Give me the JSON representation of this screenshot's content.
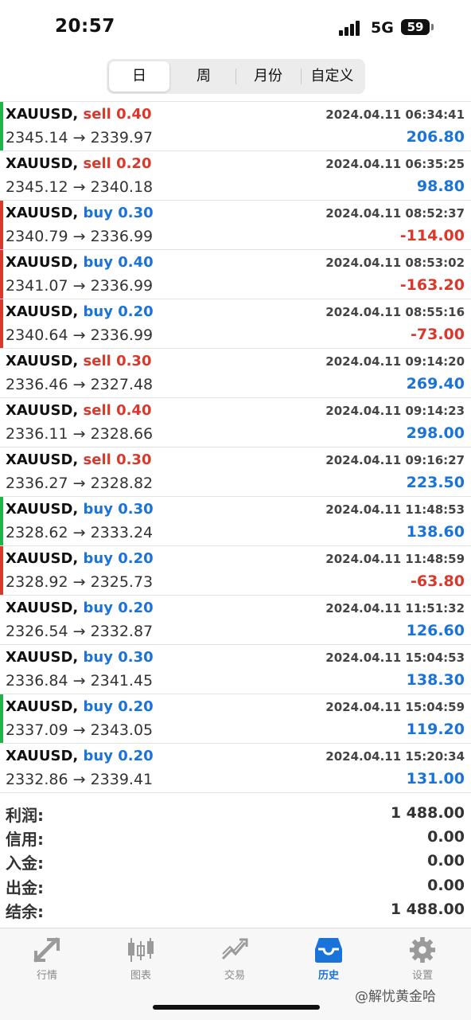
{
  "status_bar": {
    "time": "20:57",
    "network": "5G",
    "battery": "59"
  },
  "period_tabs": [
    {
      "label": "日",
      "active": true
    },
    {
      "label": "周",
      "active": false
    },
    {
      "label": "月份",
      "active": false
    },
    {
      "label": "自定义",
      "active": false
    }
  ],
  "trades": [
    {
      "symbol": "XAUUSD,",
      "direction": "sell",
      "volume": "0.40",
      "prices": "2345.14 → 2339.97",
      "time": "2024.04.11 06:34:41",
      "profit": "206.80",
      "profit_color": "blue",
      "marker": "green"
    },
    {
      "symbol": "XAUUSD,",
      "direction": "sell",
      "volume": "0.20",
      "prices": "2345.12 → 2340.18",
      "time": "2024.04.11 06:35:25",
      "profit": "98.80",
      "profit_color": "blue",
      "marker": "none"
    },
    {
      "symbol": "XAUUSD,",
      "direction": "buy",
      "volume": "0.30",
      "prices": "2340.79 → 2336.99",
      "time": "2024.04.11 08:52:37",
      "profit": "-114.00",
      "profit_color": "red",
      "marker": "red"
    },
    {
      "symbol": "XAUUSD,",
      "direction": "buy",
      "volume": "0.40",
      "prices": "2341.07 → 2336.99",
      "time": "2024.04.11 08:53:02",
      "profit": "-163.20",
      "profit_color": "red",
      "marker": "red"
    },
    {
      "symbol": "XAUUSD,",
      "direction": "buy",
      "volume": "0.20",
      "prices": "2340.64 → 2336.99",
      "time": "2024.04.11 08:55:16",
      "profit": "-73.00",
      "profit_color": "red",
      "marker": "red"
    },
    {
      "symbol": "XAUUSD,",
      "direction": "sell",
      "volume": "0.30",
      "prices": "2336.46 → 2327.48",
      "time": "2024.04.11 09:14:20",
      "profit": "269.40",
      "profit_color": "blue",
      "marker": "none"
    },
    {
      "symbol": "XAUUSD,",
      "direction": "sell",
      "volume": "0.40",
      "prices": "2336.11 → 2328.66",
      "time": "2024.04.11 09:14:23",
      "profit": "298.00",
      "profit_color": "blue",
      "marker": "none"
    },
    {
      "symbol": "XAUUSD,",
      "direction": "sell",
      "volume": "0.30",
      "prices": "2336.27 → 2328.82",
      "time": "2024.04.11 09:16:27",
      "profit": "223.50",
      "profit_color": "blue",
      "marker": "none"
    },
    {
      "symbol": "XAUUSD,",
      "direction": "buy",
      "volume": "0.30",
      "prices": "2328.62 → 2333.24",
      "time": "2024.04.11 11:48:53",
      "profit": "138.60",
      "profit_color": "blue",
      "marker": "green"
    },
    {
      "symbol": "XAUUSD,",
      "direction": "buy",
      "volume": "0.20",
      "prices": "2328.92 → 2325.73",
      "time": "2024.04.11 11:48:59",
      "profit": "-63.80",
      "profit_color": "red",
      "marker": "red"
    },
    {
      "symbol": "XAUUSD,",
      "direction": "buy",
      "volume": "0.20",
      "prices": "2326.54 → 2332.87",
      "time": "2024.04.11 11:51:32",
      "profit": "126.60",
      "profit_color": "blue",
      "marker": "none"
    },
    {
      "symbol": "XAUUSD,",
      "direction": "buy",
      "volume": "0.30",
      "prices": "2336.84 → 2341.45",
      "time": "2024.04.11 15:04:53",
      "profit": "138.30",
      "profit_color": "blue",
      "marker": "none"
    },
    {
      "symbol": "XAUUSD,",
      "direction": "buy",
      "volume": "0.20",
      "prices": "2337.09 → 2343.05",
      "time": "2024.04.11 15:04:59",
      "profit": "119.20",
      "profit_color": "blue",
      "marker": "green"
    },
    {
      "symbol": "XAUUSD,",
      "direction": "buy",
      "volume": "0.20",
      "prices": "2332.86 → 2339.41",
      "time": "2024.04.11 15:20:34",
      "profit": "131.00",
      "profit_color": "blue",
      "marker": "none"
    }
  ],
  "summary": [
    {
      "label": "利润:",
      "value": "1 488.00"
    },
    {
      "label": "信用:",
      "value": "0.00"
    },
    {
      "label": "入金:",
      "value": "0.00"
    },
    {
      "label": "出金:",
      "value": "0.00"
    },
    {
      "label": "结余:",
      "value": "1 488.00"
    }
  ],
  "bottom_tabs": [
    {
      "label": "行情",
      "icon": "quotes-icon",
      "active": false
    },
    {
      "label": "图表",
      "icon": "candlestick-chart-icon",
      "active": false
    },
    {
      "label": "交易",
      "icon": "trade-icon",
      "active": false
    },
    {
      "label": "历史",
      "icon": "history-inbox-icon",
      "active": true
    },
    {
      "label": "设置",
      "icon": "gear-icon",
      "active": false
    }
  ],
  "watermark": "@解忧黄金哈",
  "colors": {
    "buy_blue": "#1a73d8",
    "sell_red": "#d9382b",
    "marker_green": "#22b24c",
    "marker_red": "#d9382b"
  }
}
